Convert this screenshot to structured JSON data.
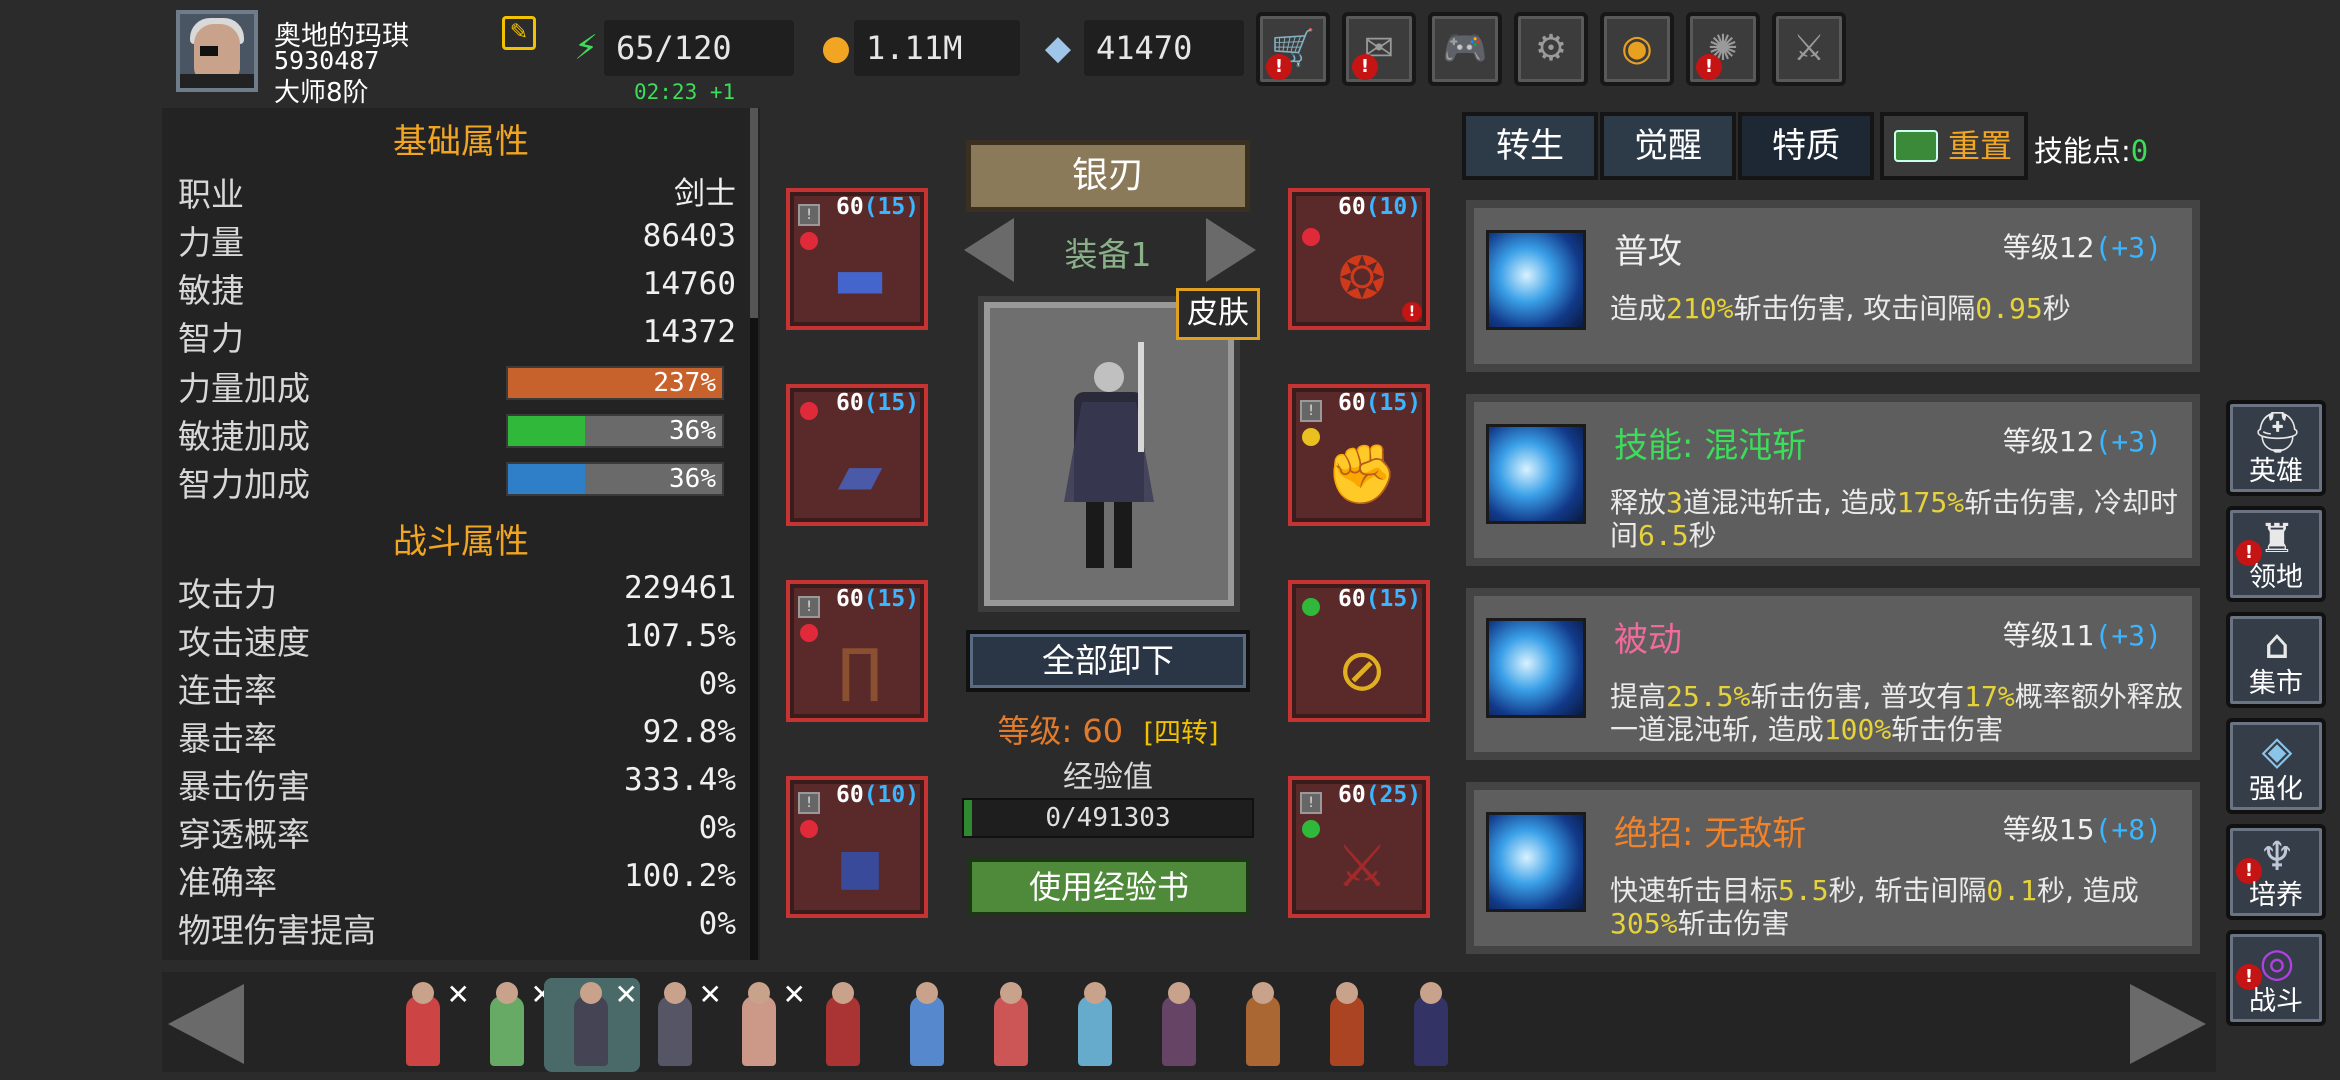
{
  "player": {
    "name": "奥地的玛琪",
    "id": "5930487",
    "rank": "大师8阶"
  },
  "resources": {
    "energy": "65/120",
    "gold": "1.11M",
    "gems": "41470",
    "timer": "02:23 +1"
  },
  "top_buttons": [
    "cart-icon",
    "mail-icon",
    "gamepad-icon",
    "gear-icon",
    "aperture-icon",
    "fireworks-icon",
    "crossed-swords-icon"
  ],
  "left": {
    "basic_title": "基础属性",
    "basic": [
      {
        "label": "职业",
        "value": "剑士"
      },
      {
        "label": "力量",
        "value": "86403"
      },
      {
        "label": "敏捷",
        "value": "14760"
      },
      {
        "label": "智力",
        "value": "14372"
      }
    ],
    "bonuses": [
      {
        "label": "力量加成",
        "value": "237%",
        "fill": 1.0,
        "color": "#c8622c"
      },
      {
        "label": "敏捷加成",
        "value": "36%",
        "fill": 0.36,
        "color": "#2fb83a"
      },
      {
        "label": "智力加成",
        "value": "36%",
        "fill": 0.36,
        "color": "#2e7ec8"
      }
    ],
    "combat_title": "战斗属性",
    "combat": [
      {
        "label": "攻击力",
        "value": "229461"
      },
      {
        "label": "攻击速度",
        "value": "107.5%"
      },
      {
        "label": "连击率",
        "value": "0%"
      },
      {
        "label": "暴击率",
        "value": "92.8%"
      },
      {
        "label": "暴击伤害",
        "value": "333.4%"
      },
      {
        "label": "穿透概率",
        "value": "0%"
      },
      {
        "label": "准确率",
        "value": "100.2%"
      },
      {
        "label": "物理伤害提高",
        "value": "0%"
      }
    ]
  },
  "equipment": {
    "set_name": "银刃",
    "set_label": "装备1",
    "skin_label": "皮肤",
    "slots_left": [
      {
        "lvl": "60",
        "plus": "(15)",
        "gem": "#e02a3a",
        "icon": "belt"
      },
      {
        "lvl": "60",
        "plus": "(15)",
        "gem": "#e02a3a",
        "icon": "armor"
      },
      {
        "lvl": "60",
        "plus": "(15)",
        "gem": "#e02a3a",
        "icon": "pants"
      },
      {
        "lvl": "60",
        "plus": "(10)",
        "gem": "#e02a3a",
        "icon": "boots"
      }
    ],
    "slots_right": [
      {
        "lvl": "60",
        "plus": "(10)",
        "gem": "#e02a3a",
        "icon": "necklace"
      },
      {
        "lvl": "60",
        "plus": "(15)",
        "gem": "#e8c020",
        "icon": "gauntlets"
      },
      {
        "lvl": "60",
        "plus": "(15)",
        "gem": "#2fb83a",
        "icon": "amulet"
      },
      {
        "lvl": "60",
        "plus": "(25)",
        "gem": "#2fb83a",
        "icon": "sword"
      }
    ],
    "unequip_label": "全部卸下",
    "level_text": "等级: 60",
    "stage_text": "[四转]",
    "exp_label": "经验值",
    "exp_value": "0/491303",
    "use_book_label": "使用经验书"
  },
  "right": {
    "tabs": [
      "转生",
      "觉醒",
      "特质"
    ],
    "reset_label": "重置",
    "skill_points_label": "技能点:",
    "skill_points_value": "0",
    "skills": [
      {
        "name": "普攻",
        "name_color": "#f0f0f0",
        "level": "等级12",
        "bonus": "(+3)",
        "desc": [
          [
            "造成",
            ""
          ],
          [
            "210%",
            "h"
          ],
          [
            "斩击伤害, 攻击间隔",
            ""
          ],
          [
            "0.95",
            "h"
          ],
          [
            "秒",
            ""
          ]
        ]
      },
      {
        "name": "技能: 混沌斩",
        "name_color": "#3ddc5a",
        "level": "等级12",
        "bonus": "(+3)",
        "desc": [
          [
            "释放",
            ""
          ],
          [
            "3",
            "h"
          ],
          [
            "道混沌斩击, 造成",
            ""
          ],
          [
            "175%",
            "h"
          ],
          [
            "斩击伤害, 冷却时间",
            ""
          ],
          [
            "6.5",
            "h"
          ],
          [
            "秒",
            ""
          ]
        ]
      },
      {
        "name": "被动",
        "name_color": "#f06a9a",
        "level": "等级11",
        "bonus": "(+3)",
        "desc": [
          [
            "提高",
            ""
          ],
          [
            "25.5%",
            "h"
          ],
          [
            "斩击伤害, 普攻有",
            ""
          ],
          [
            "17%",
            "h"
          ],
          [
            "概率额外释放一道混沌斩, 造成",
            ""
          ],
          [
            "100%",
            "h"
          ],
          [
            "斩击伤害",
            ""
          ]
        ]
      },
      {
        "name": "绝招: 无敌斩",
        "name_color": "#f0822a",
        "level": "等级15",
        "bonus": "(+8)",
        "desc": [
          [
            "快速斩击目标",
            ""
          ],
          [
            "5.5",
            "h"
          ],
          [
            "秒, 斩击间隔",
            ""
          ],
          [
            "0.1",
            "h"
          ],
          [
            "秒, 造成",
            ""
          ],
          [
            "305%",
            "h"
          ],
          [
            "斩击伤害",
            ""
          ]
        ]
      }
    ]
  },
  "side_nav": [
    {
      "label": "英雄",
      "icon": "helmet-icon",
      "alert": false
    },
    {
      "label": "领地",
      "icon": "castle-icon",
      "alert": true
    },
    {
      "label": "集市",
      "icon": "shop-icon",
      "alert": false
    },
    {
      "label": "强化",
      "icon": "crystal-icon",
      "alert": false
    },
    {
      "label": "培养",
      "icon": "chalice-icon",
      "alert": true
    },
    {
      "label": "战斗",
      "icon": "portal-icon",
      "alert": true
    }
  ],
  "heroes": [
    {
      "color": "#c44",
      "x": true,
      "sel": false
    },
    {
      "color": "#6a6",
      "x": true,
      "sel": false
    },
    {
      "color": "#445",
      "x": true,
      "sel": true
    },
    {
      "color": "#556",
      "x": true,
      "sel": false
    },
    {
      "color": "#c98",
      "x": true,
      "sel": false
    },
    {
      "color": "#a33",
      "x": false,
      "sel": false
    },
    {
      "color": "#58c",
      "x": false,
      "sel": false
    },
    {
      "color": "#c55",
      "x": false,
      "sel": false
    },
    {
      "color": "#6ac",
      "x": false,
      "sel": false
    },
    {
      "color": "#646",
      "x": false,
      "sel": false
    },
    {
      "color": "#a63",
      "x": false,
      "sel": false
    },
    {
      "color": "#a42",
      "x": false,
      "sel": false
    },
    {
      "color": "#336",
      "x": false,
      "sel": false
    }
  ]
}
